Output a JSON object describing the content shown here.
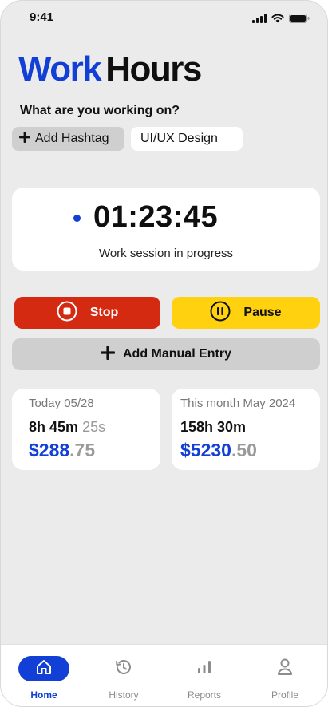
{
  "status_bar": {
    "time": "9:41"
  },
  "app": {
    "logo_part1": "Work",
    "logo_part2": "Hours"
  },
  "prompt": {
    "question": "What are you working on?"
  },
  "tags": {
    "add_label": "Add Hashtag",
    "current_value": "UI/UX Design"
  },
  "timer": {
    "value": "01:23:45",
    "status": "Work session in progress"
  },
  "actions": {
    "stop_label": "Stop",
    "pause_label": "Pause",
    "manual_label": "Add Manual Entry"
  },
  "today": {
    "label": "Today 05/28",
    "hours": "8h 45m",
    "seconds": "25s",
    "amount_whole": "$288",
    "amount_cents": ".75"
  },
  "month": {
    "label": "This month May 2024",
    "hours": "158h 30m",
    "amount_whole": "$5230",
    "amount_cents": ".50"
  },
  "tabbar": {
    "home": "Home",
    "history": "History",
    "reports": "Reports",
    "profile": "Profile"
  },
  "colors": {
    "brand": "#1240d6",
    "stop": "#d42a12",
    "pause": "#ffd10f",
    "background": "#ebebeb"
  },
  "icons": [
    "signal-icon",
    "wifi-icon",
    "battery-icon",
    "plus-icon",
    "stop-icon",
    "pause-icon",
    "home-icon",
    "history-icon",
    "reports-icon",
    "profile-icon"
  ]
}
